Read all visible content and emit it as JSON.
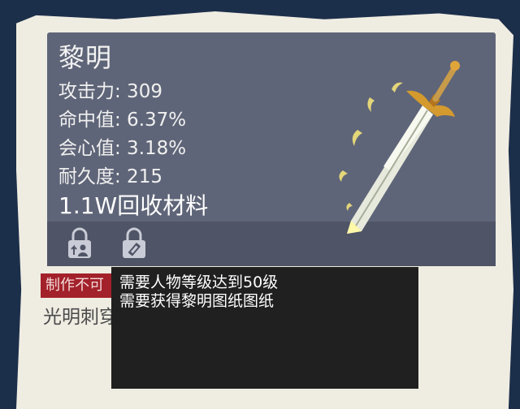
{
  "weapon": {
    "name": "黎明",
    "stats": [
      {
        "text": "攻击力: 309"
      },
      {
        "text": "命中值: 6.37%"
      },
      {
        "text": "会心值: 3.18%"
      },
      {
        "text": "耐久度: 215"
      }
    ],
    "recycle_text": "1.1W回收材料",
    "description": "光明刺穿黑暗，军团永垂不朽。"
  },
  "icons": [
    "upgrade-lock-icon",
    "dismantle-lock-icon",
    "sword-icon"
  ],
  "status_badge": "制作不可",
  "tooltip": {
    "lines": [
      "需要人物等级达到50级",
      "需要获得黎明图纸图纸"
    ]
  }
}
